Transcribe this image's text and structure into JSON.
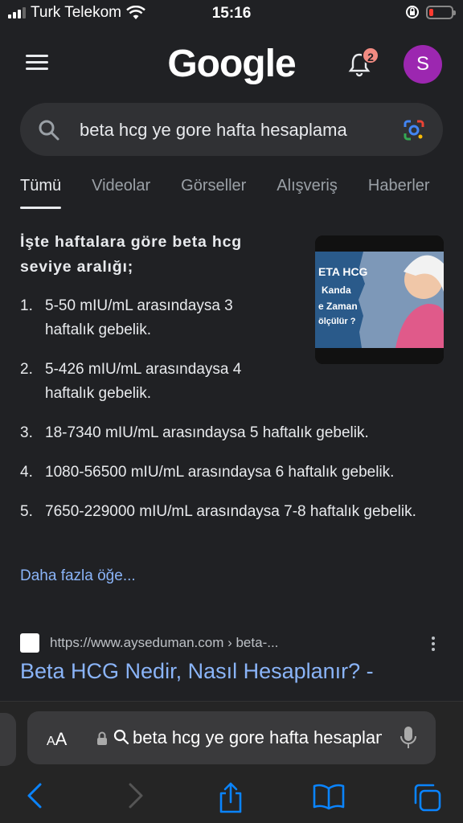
{
  "status": {
    "carrier": "Turk Telekom",
    "time": "15:16",
    "battery_color": "#ff3b30"
  },
  "header": {
    "logo": "Google",
    "notifications_count": "2",
    "avatar_letter": "S",
    "avatar_color": "#9c27b0"
  },
  "search": {
    "query": "beta hcg ye gore hafta hesaplama"
  },
  "tabs": [
    "Tümü",
    "Videolar",
    "Görseller",
    "Alışveriş",
    "Haberler"
  ],
  "snippet": {
    "heading": "İşte haftalara göre beta hcg seviye aralığı;",
    "items": [
      {
        "num": "1.",
        "text": "5-50 mIU/mL arasındaysa 3 haftalık gebelik."
      },
      {
        "num": "2.",
        "text": "5-426 mIU/mL arasındaysa 4 haftalık gebelik."
      },
      {
        "num": "3.",
        "text": "18-7340 mIU/mL arasındaysa 5 haftalık gebelik."
      },
      {
        "num": "4.",
        "text": "1080-56500 mIU/mL arasındaysa 6 haftalık gebelik."
      },
      {
        "num": "5.",
        "text": "7650-229000 mIU/mL arasındaysa 7-8 haftalık gebelik."
      }
    ],
    "more_link": "Daha fazla öğe...",
    "thumbnail_text": [
      "ETA HCG",
      "Kanda",
      "e Zaman",
      "ölçülür ?"
    ]
  },
  "result": {
    "url": "https://www.ayseduman.com › beta-...",
    "title": "Beta HCG Nedir, Nasıl Hesaplanır? -"
  },
  "safari": {
    "aa_small": "A",
    "aa_big": "A",
    "address_text": "beta hcg ye gore hafta hesaplama"
  }
}
